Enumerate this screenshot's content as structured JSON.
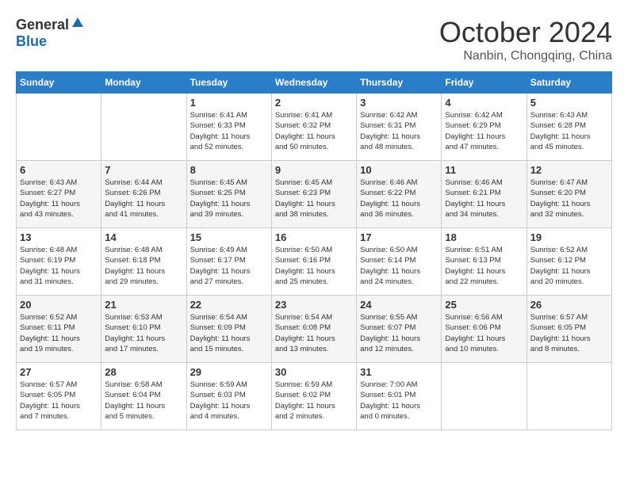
{
  "header": {
    "logo_general": "General",
    "logo_blue": "Blue",
    "title": "October 2024",
    "location": "Nanbin, Chongqing, China"
  },
  "days_of_week": [
    "Sunday",
    "Monday",
    "Tuesday",
    "Wednesday",
    "Thursday",
    "Friday",
    "Saturday"
  ],
  "weeks": [
    [
      {
        "day": "",
        "content": ""
      },
      {
        "day": "",
        "content": ""
      },
      {
        "day": "1",
        "content": "Sunrise: 6:41 AM\nSunset: 6:33 PM\nDaylight: 11 hours\nand 52 minutes."
      },
      {
        "day": "2",
        "content": "Sunrise: 6:41 AM\nSunset: 6:32 PM\nDaylight: 11 hours\nand 50 minutes."
      },
      {
        "day": "3",
        "content": "Sunrise: 6:42 AM\nSunset: 6:31 PM\nDaylight: 11 hours\nand 48 minutes."
      },
      {
        "day": "4",
        "content": "Sunrise: 6:42 AM\nSunset: 6:29 PM\nDaylight: 11 hours\nand 47 minutes."
      },
      {
        "day": "5",
        "content": "Sunrise: 6:43 AM\nSunset: 6:28 PM\nDaylight: 11 hours\nand 45 minutes."
      }
    ],
    [
      {
        "day": "6",
        "content": "Sunrise: 6:43 AM\nSunset: 6:27 PM\nDaylight: 11 hours\nand 43 minutes."
      },
      {
        "day": "7",
        "content": "Sunrise: 6:44 AM\nSunset: 6:26 PM\nDaylight: 11 hours\nand 41 minutes."
      },
      {
        "day": "8",
        "content": "Sunrise: 6:45 AM\nSunset: 6:25 PM\nDaylight: 11 hours\nand 39 minutes."
      },
      {
        "day": "9",
        "content": "Sunrise: 6:45 AM\nSunset: 6:23 PM\nDaylight: 11 hours\nand 38 minutes."
      },
      {
        "day": "10",
        "content": "Sunrise: 6:46 AM\nSunset: 6:22 PM\nDaylight: 11 hours\nand 36 minutes."
      },
      {
        "day": "11",
        "content": "Sunrise: 6:46 AM\nSunset: 6:21 PM\nDaylight: 11 hours\nand 34 minutes."
      },
      {
        "day": "12",
        "content": "Sunrise: 6:47 AM\nSunset: 6:20 PM\nDaylight: 11 hours\nand 32 minutes."
      }
    ],
    [
      {
        "day": "13",
        "content": "Sunrise: 6:48 AM\nSunset: 6:19 PM\nDaylight: 11 hours\nand 31 minutes."
      },
      {
        "day": "14",
        "content": "Sunrise: 6:48 AM\nSunset: 6:18 PM\nDaylight: 11 hours\nand 29 minutes."
      },
      {
        "day": "15",
        "content": "Sunrise: 6:49 AM\nSunset: 6:17 PM\nDaylight: 11 hours\nand 27 minutes."
      },
      {
        "day": "16",
        "content": "Sunrise: 6:50 AM\nSunset: 6:16 PM\nDaylight: 11 hours\nand 25 minutes."
      },
      {
        "day": "17",
        "content": "Sunrise: 6:50 AM\nSunset: 6:14 PM\nDaylight: 11 hours\nand 24 minutes."
      },
      {
        "day": "18",
        "content": "Sunrise: 6:51 AM\nSunset: 6:13 PM\nDaylight: 11 hours\nand 22 minutes."
      },
      {
        "day": "19",
        "content": "Sunrise: 6:52 AM\nSunset: 6:12 PM\nDaylight: 11 hours\nand 20 minutes."
      }
    ],
    [
      {
        "day": "20",
        "content": "Sunrise: 6:52 AM\nSunset: 6:11 PM\nDaylight: 11 hours\nand 19 minutes."
      },
      {
        "day": "21",
        "content": "Sunrise: 6:53 AM\nSunset: 6:10 PM\nDaylight: 11 hours\nand 17 minutes."
      },
      {
        "day": "22",
        "content": "Sunrise: 6:54 AM\nSunset: 6:09 PM\nDaylight: 11 hours\nand 15 minutes."
      },
      {
        "day": "23",
        "content": "Sunrise: 6:54 AM\nSunset: 6:08 PM\nDaylight: 11 hours\nand 13 minutes."
      },
      {
        "day": "24",
        "content": "Sunrise: 6:55 AM\nSunset: 6:07 PM\nDaylight: 11 hours\nand 12 minutes."
      },
      {
        "day": "25",
        "content": "Sunrise: 6:56 AM\nSunset: 6:06 PM\nDaylight: 11 hours\nand 10 minutes."
      },
      {
        "day": "26",
        "content": "Sunrise: 6:57 AM\nSunset: 6:05 PM\nDaylight: 11 hours\nand 8 minutes."
      }
    ],
    [
      {
        "day": "27",
        "content": "Sunrise: 6:57 AM\nSunset: 6:05 PM\nDaylight: 11 hours\nand 7 minutes."
      },
      {
        "day": "28",
        "content": "Sunrise: 6:58 AM\nSunset: 6:04 PM\nDaylight: 11 hours\nand 5 minutes."
      },
      {
        "day": "29",
        "content": "Sunrise: 6:59 AM\nSunset: 6:03 PM\nDaylight: 11 hours\nand 4 minutes."
      },
      {
        "day": "30",
        "content": "Sunrise: 6:59 AM\nSunset: 6:02 PM\nDaylight: 11 hours\nand 2 minutes."
      },
      {
        "day": "31",
        "content": "Sunrise: 7:00 AM\nSunset: 6:01 PM\nDaylight: 11 hours\nand 0 minutes."
      },
      {
        "day": "",
        "content": ""
      },
      {
        "day": "",
        "content": ""
      }
    ]
  ]
}
